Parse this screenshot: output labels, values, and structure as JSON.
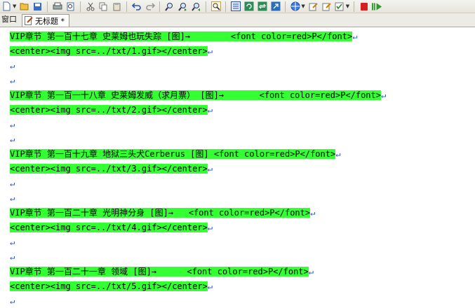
{
  "window_label": "窗口",
  "tab": {
    "title": "无标题 *",
    "icon": "document-edit-icon"
  },
  "toolbar": {
    "icons": [
      "new-file-icon",
      "open-folder-icon",
      "save-icon",
      "print-icon",
      "print-preview-icon",
      "cut-icon",
      "copy-icon",
      "paste-icon",
      "undo-icon",
      "redo-icon",
      "find-icon",
      "find-next-icon",
      "find-prev-icon",
      "zoom-icon",
      "view-mode-icon",
      "refresh-icon",
      "sync-icon",
      "export-icon",
      "web-icon",
      "edit-note-icon",
      "edit-note-2-icon",
      "checklist-icon",
      "stop-icon",
      "play-icon"
    ]
  },
  "colors": {
    "highlight": "#33ff33",
    "marker": "#2255cc"
  },
  "editor": {
    "lines": [
      {
        "text": "VIP章节 第一百十七章 史莱姆也玩失踪 [图]→        <font color=red>P</font>",
        "highlight": true
      },
      {
        "text": "<center><img src=../txt/1.gif></center>",
        "highlight": true
      },
      {
        "text": "",
        "highlight": false
      },
      {
        "text": "",
        "highlight": false
      },
      {
        "text": "VIP章节 第一百一十八章 史莱姆发威（求月票） [图]→       <font color=red>P</font>",
        "highlight": true
      },
      {
        "text": "<center><img src=../txt/2.gif></center>",
        "highlight": true
      },
      {
        "text": "",
        "highlight": false
      },
      {
        "text": "",
        "highlight": false
      },
      {
        "text": "VIP章节 第一百十九章 地狱三头犬Cerberus [图] <font color=red>P</font>",
        "highlight": true
      },
      {
        "text": "<center><img src=../txt/3.gif></center>",
        "highlight": true
      },
      {
        "text": "",
        "highlight": false
      },
      {
        "text": "",
        "highlight": false
      },
      {
        "text": "VIP章节 第一百二十章 光明神分身 [图]→   <font color=red>P</font>",
        "highlight": true
      },
      {
        "text": "<center><img src=../txt/4.gif></center>",
        "highlight": true
      },
      {
        "text": "",
        "highlight": false
      },
      {
        "text": "",
        "highlight": false
      },
      {
        "text": "VIP章节 第一百二十一章 领域 [图]→      <font color=red>P</font>",
        "highlight": true
      },
      {
        "text": "<center><img src=../txt/5.gif></center>",
        "highlight": true
      },
      {
        "text": "",
        "highlight": false
      }
    ]
  }
}
